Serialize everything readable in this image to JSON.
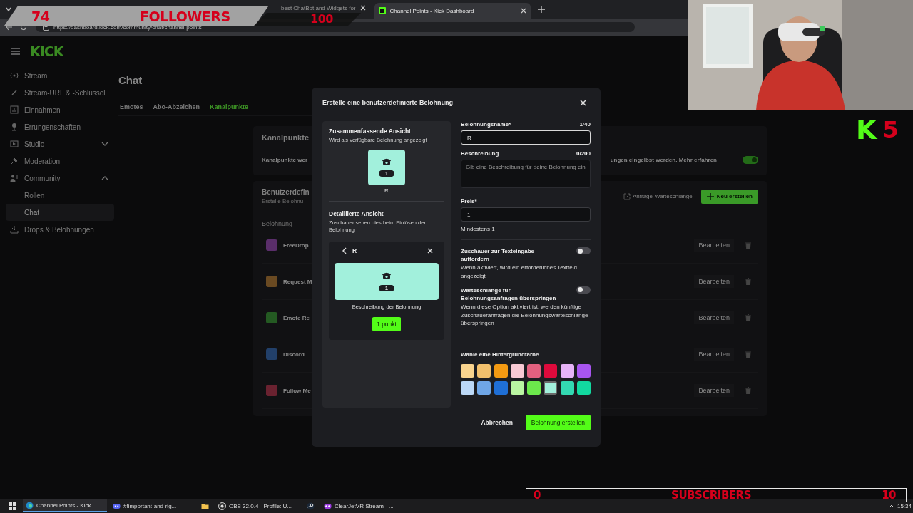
{
  "browser": {
    "tabs": [
      {
        "title": "best ChatBot and Widgets for",
        "selected": false
      },
      {
        "title": "Channel Points - Kick Dashboard",
        "selected": true
      }
    ],
    "url": "https://dashboard.kick.com/community/chat/channel-points"
  },
  "sidebar": {
    "logo": "KICK",
    "items": [
      {
        "label": "Stream",
        "selected": false
      },
      {
        "label": "Stream-URL & -Schlüssel",
        "selected": false
      },
      {
        "label": "Einnahmen",
        "selected": false
      },
      {
        "label": "Errungenschaften",
        "selected": false
      },
      {
        "label": "Studio",
        "selected": false,
        "expanded": false
      },
      {
        "label": "Moderation",
        "selected": false
      },
      {
        "label": "Community",
        "selected": false,
        "expanded": true,
        "children": [
          {
            "label": "Rollen",
            "selected": false
          },
          {
            "label": "Chat",
            "selected": true
          }
        ]
      },
      {
        "label": "Drops & Belohnungen",
        "selected": false
      }
    ]
  },
  "main": {
    "heading": "Chat",
    "tabs": [
      {
        "label": "Emotes",
        "selected": false
      },
      {
        "label": "Abo-Abzeichen",
        "selected": false
      },
      {
        "label": "Kanalpunkte",
        "selected": true
      }
    ],
    "points_card": {
      "title": "Kanalpunkte",
      "text_start": "Kanalpunkte wer",
      "text_end": "ungen eingelöst werden. Mehr erfahren",
      "on": true
    },
    "rewards_card": {
      "title": "Benutzerdefin",
      "subtitle": "Erstelle Belohnu",
      "queue_link": "Anfrage-Warteschlange",
      "new_button": "Neu erstellen",
      "column": "Belohnung",
      "rows": [
        {
          "name": "FreeDrop",
          "color": "#5a2e6a",
          "action": "Bearbeiten"
        },
        {
          "name": "Request M",
          "color": "#6a4a22",
          "action": "Bearbeiten"
        },
        {
          "name": "Emote Re",
          "color": "#245a22",
          "action": "Bearbeiten"
        },
        {
          "name": "Discord",
          "color": "#22406a",
          "action": "Bearbeiten"
        },
        {
          "name": "Follow Me",
          "color": "#6a2230",
          "action": "Bearbeiten"
        }
      ]
    }
  },
  "modal": {
    "title": "Erstelle eine benutzerdefinierte Belohnung",
    "summary": {
      "title": "Zusammenfassende Ansicht",
      "subtitle": "Wird als verfügbare Belohnung angezeigt",
      "cost": "1",
      "name": "R"
    },
    "detail": {
      "title": "Detaillierte Ansicht",
      "subtitle": "Zuschauer sehen dies beim Einlösen der Belohnung",
      "name": "R",
      "cost": "1",
      "description": "Beschreibung der Belohnung",
      "button": "1 punkt"
    },
    "name_field": {
      "label": "Belohnungsname*",
      "count": "1/40",
      "value": "R"
    },
    "description_field": {
      "label": "Beschreibung",
      "count": "0/200",
      "placeholder": "Gib eine Beschreibung für deine Belohnung ein"
    },
    "price_field": {
      "label": "Preis*",
      "value": "1",
      "hint": "Mindestens 1"
    },
    "toggles": [
      {
        "title": "Zuschauer zur Texteingabe auffordern",
        "description": "Wenn aktiviert, wird ein erforderliches Textfeld angezeigt",
        "on": false
      },
      {
        "title": "Warteschlange für Belohnungsanfragen überspringen",
        "description": "Wenn diese Option aktiviert ist, werden künftige Zuschaueranfragen die Belohnungswarteschlange überspringen",
        "on": false
      }
    ],
    "color_label": "Wähle eine Hintergrundfarbe",
    "colors": [
      {
        "color": "#f9d48e",
        "selected": false
      },
      {
        "color": "#f2c06c",
        "selected": false
      },
      {
        "color": "#f39a12",
        "selected": false
      },
      {
        "color": "#f8c9d4",
        "selected": false
      },
      {
        "color": "#e2607f",
        "selected": false
      },
      {
        "color": "#de0a3c",
        "selected": false
      },
      {
        "color": "#e6b3f7",
        "selected": false
      },
      {
        "color": "#a855f0",
        "selected": false
      },
      {
        "color": "#bcd8f6",
        "selected": false
      },
      {
        "color": "#6fa6e6",
        "selected": false
      },
      {
        "color": "#1f6fd6",
        "selected": false
      },
      {
        "color": "#baf6a2",
        "selected": false
      },
      {
        "color": "#6ce84c",
        "selected": false
      },
      {
        "color": "#a2f0dc",
        "selected": true
      },
      {
        "color": "#33d9b2",
        "selected": false
      },
      {
        "color": "#12d9a0",
        "selected": false
      }
    ],
    "cancel": "Abbrechen",
    "submit": "Belohnung erstellen"
  },
  "overlays": {
    "followers": {
      "count": "74",
      "label": "FOLLOWERS",
      "goal": "100"
    },
    "badge": {
      "letter": "K",
      "count": "5"
    },
    "subscribers": {
      "count": "0",
      "label": "SUBSCRIBERS",
      "goal": "10"
    }
  },
  "taskbar": {
    "items": [
      {
        "kind": "start",
        "selected": false
      },
      {
        "kind": "app",
        "label": "Channel Points - Kick...",
        "selected": true
      },
      {
        "kind": "app",
        "label": "#!important-and-rig...",
        "selected": false
      },
      {
        "kind": "icon",
        "selected": false
      },
      {
        "kind": "app",
        "label": "OBS 32.0.4 - Profile: U...",
        "selected": false
      },
      {
        "kind": "icon",
        "selected": false
      },
      {
        "kind": "app",
        "label": "ClearJetVR Stream - ...",
        "selected": false
      }
    ],
    "clock": "15:34"
  }
}
